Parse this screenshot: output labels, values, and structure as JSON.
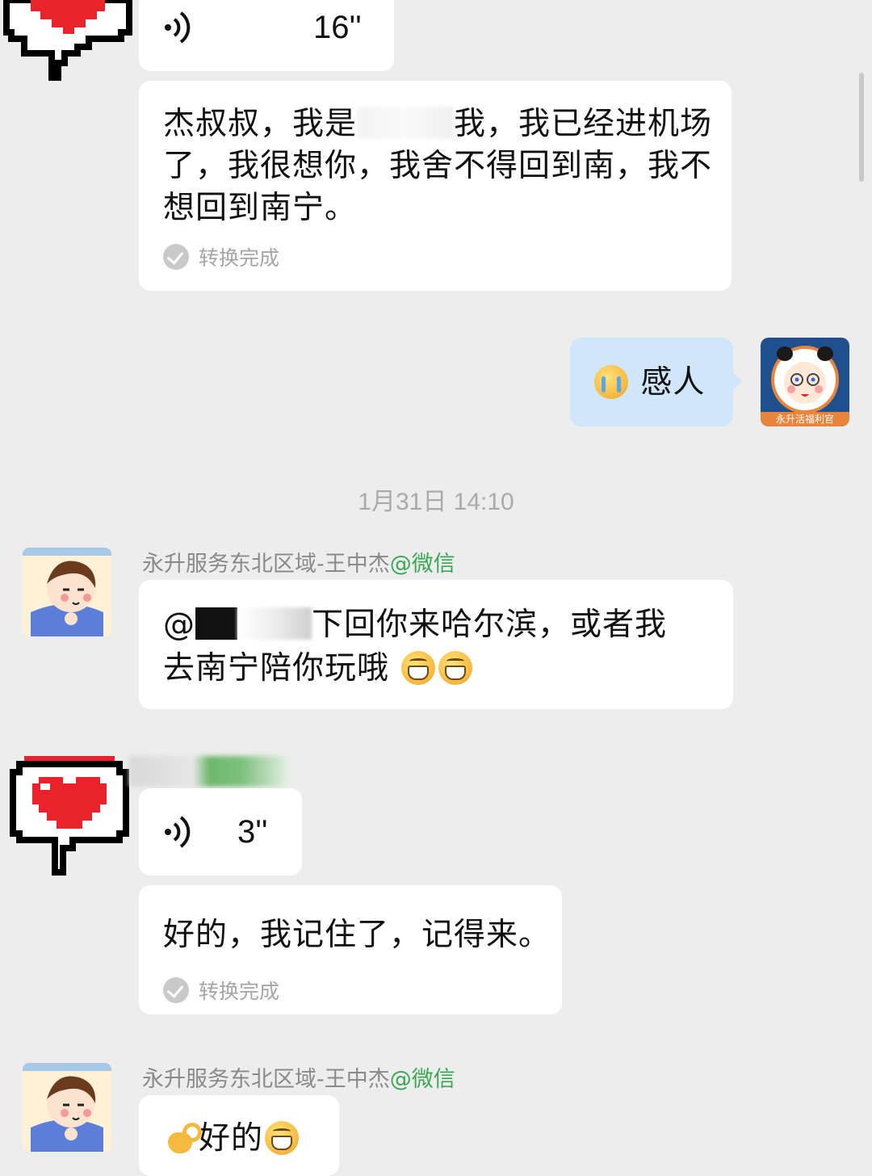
{
  "chat": {
    "messages": [
      {
        "type": "voice",
        "duration": "16''"
      },
      {
        "type": "transcript",
        "text_line1": "杰叔叔，我是",
        "text_line1b": "我，我已经进机场",
        "text_line2": "了，我很想你，我舍不得回到南，我不",
        "text_line3": "想回到南宁。",
        "status": "转换完成"
      },
      {
        "type": "outgoing_text",
        "text": "感人",
        "avatar_badge": "永升活福利官"
      },
      {
        "type": "timestamp",
        "text": "1月31日 14:10"
      },
      {
        "type": "incoming_text",
        "sender": "永升服务东北区域-王中杰",
        "sender_tag": "@微信",
        "text_line1": "下回你来哈尔滨，或者我",
        "mention": "@",
        "text_line2": "去南宁陪你玩哦"
      },
      {
        "type": "voice",
        "duration": "3''"
      },
      {
        "type": "transcript",
        "text": "好的，我记住了，记得来。",
        "status": "转换完成"
      },
      {
        "type": "incoming_text",
        "sender": "永升服务东北区域-王中杰",
        "sender_tag": "@微信",
        "text": "好的"
      }
    ]
  },
  "colors": {
    "background": "#ededed",
    "bubble_incoming": "#ffffff",
    "bubble_outgoing": "#cfe6fb",
    "sender_tag": "#3aa853",
    "status_text": "#a6a6a6"
  },
  "icons": [
    "heart-avatar",
    "voice-wave-icon",
    "check-icon",
    "grin-emoji",
    "cry-emoji",
    "ok-hand-emoji",
    "cartoon-avatar"
  ]
}
